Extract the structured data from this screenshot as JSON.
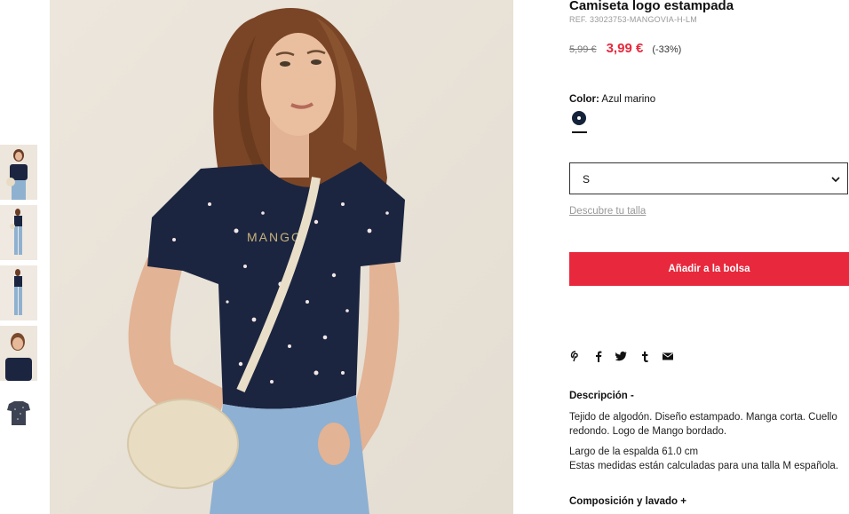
{
  "product": {
    "title": "Camiseta logo estampada",
    "ref": "REF. 33023753-MANGOVIA-H-LM",
    "old_price": "5,99 €",
    "new_price": "3,99 €",
    "discount": "(-33%)"
  },
  "color": {
    "label": "Color:",
    "value": "Azul marino",
    "swatch_hex": "#14223a"
  },
  "size": {
    "selected": "S",
    "guide_link": "Descubre tu talla"
  },
  "cta": {
    "add_to_bag": "Añadir a la bolsa",
    "accent": "#e8283c"
  },
  "share_icons": [
    "pinterest-icon",
    "facebook-icon",
    "twitter-icon",
    "tumblr-icon",
    "mail-icon"
  ],
  "description": {
    "title": "Descripción -",
    "text": "Tejido de algodón. Diseño estampado. Manga corta. Cuello redondo. Logo de Mango bordado.",
    "measure": "Largo de la espalda 61.0 cm",
    "note": "Estas medidas están calculadas para una talla M española."
  },
  "composition": {
    "title": "Composición y lavado +"
  },
  "photo": {
    "shirt_logo": "MANGO"
  }
}
